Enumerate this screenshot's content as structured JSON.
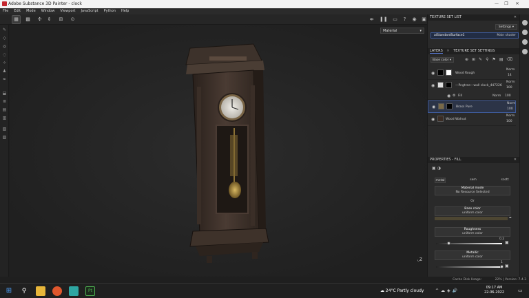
{
  "window": {
    "title": "Adobe Substance 3D Painter - clock",
    "minimize": "—",
    "maximize": "❐",
    "close": "✕"
  },
  "menu": [
    "File",
    "Edit",
    "Mode",
    "Window",
    "Viewport",
    "JavaScript",
    "Python",
    "Help"
  ],
  "viewport": {
    "shader_mode": "Material",
    "axis_label": "Z"
  },
  "texture_set_list": {
    "header": "TEXTURE SET LIST",
    "settings_label": "Settings",
    "item_name": "aiStandardSurface1",
    "item_shader": "Main shader"
  },
  "layers_panel": {
    "tab_layers": "LAYERS",
    "tab_settings": "TEXTURE SET SETTINGS",
    "channel": "Base color",
    "layers": [
      {
        "name": "Wood Rough",
        "blend": "Norm",
        "opacity": "14"
      },
      {
        "name": "—Pngtree—wall clock_447226",
        "blend": "Norm",
        "opacity": "100"
      },
      {
        "name": "Fill",
        "blend": "Norm",
        "opacity": "100"
      },
      {
        "name": "Brass Pure",
        "blend": "Norm",
        "opacity": "100"
      },
      {
        "name": "Wood Walnut",
        "blend": "Norm",
        "opacity": "100"
      }
    ]
  },
  "properties": {
    "header": "PROPERTIES - FILL",
    "material_tabs": [
      "metal",
      "sem",
      "scott"
    ],
    "material_mode_label": "Material mode",
    "material_mode_value": "No Resource Selected",
    "or_label": "Or",
    "base_color_label": "Base color",
    "base_color_value": "uniform color",
    "base_color_hex": "#4d4632",
    "roughness_label": "Roughness",
    "roughness_value_label": "uniform color",
    "roughness_value": "0.2",
    "roughness_fraction": 0.2,
    "metallic_label": "Metallic",
    "metallic_value_label": "uniform color",
    "metallic_value": "1",
    "metallic_fraction": 1.0
  },
  "status": {
    "cache": "Cache Disk Usage:",
    "cache_pct": "22%",
    "version": "Version: 7.4.3"
  },
  "taskbar": {
    "weather": "24°C  Partly cloudy",
    "time": "09:17 AM",
    "date": "22-06-2022"
  },
  "colors": {
    "accent": "#5a7bd6",
    "wood": "#3b2f28",
    "brass": "#a88a45"
  }
}
